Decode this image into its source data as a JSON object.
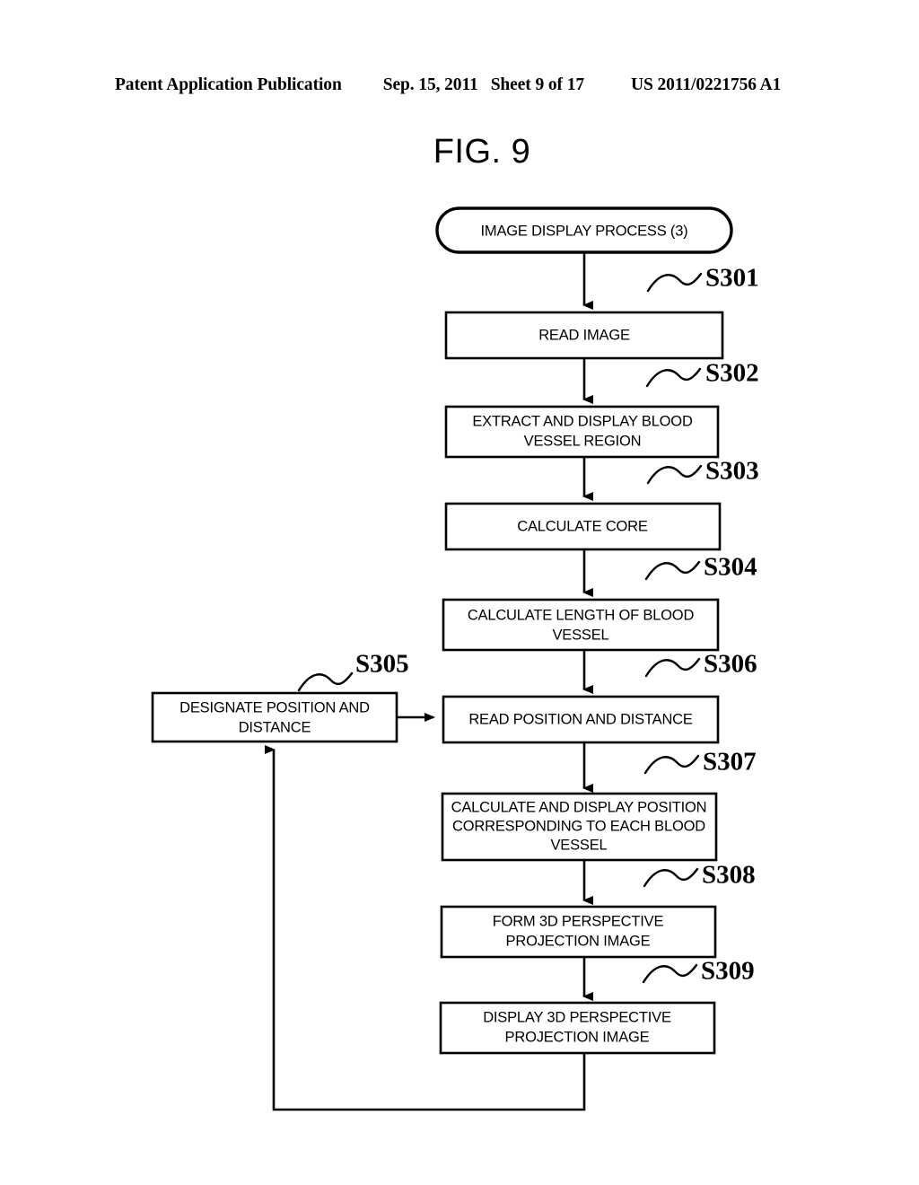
{
  "header": {
    "publication": "Patent Application Publication",
    "date": "Sep. 15, 2011",
    "sheet": "Sheet 9 of 17",
    "number": "US 2011/0221756 A1"
  },
  "figure": {
    "label": "FIG. 9"
  },
  "flowchart": {
    "terminal": {
      "label": "IMAGE DISPLAY PROCESS (3)",
      "lines": [
        "IMAGE DISPLAY PROCESS (3)"
      ]
    },
    "steps": [
      {
        "id": "S301",
        "step_label": "S301",
        "lines": [
          "READ IMAGE"
        ]
      },
      {
        "id": "S302",
        "step_label": "S302",
        "lines": [
          "EXTRACT AND DISPLAY BLOOD",
          "VESSEL REGION"
        ]
      },
      {
        "id": "S303",
        "step_label": "S303",
        "lines": [
          "CALCULATE CORE"
        ]
      },
      {
        "id": "S304",
        "step_label": "S304",
        "lines": [
          "CALCULATE LENGTH OF BLOOD",
          "VESSEL"
        ]
      },
      {
        "id": "S305",
        "step_label": "S305",
        "lines": [
          "DESIGNATE POSITION AND",
          "DISTANCE"
        ]
      },
      {
        "id": "S306",
        "step_label": "S306",
        "lines": [
          "READ POSITION AND DISTANCE"
        ]
      },
      {
        "id": "S307",
        "step_label": "S307",
        "lines": [
          "CALCULATE AND DISPLAY POSITION",
          "CORRESPONDING TO EACH BLOOD",
          "VESSEL"
        ]
      },
      {
        "id": "S308",
        "step_label": "S308",
        "lines": [
          "FORM 3D PERSPECTIVE",
          "PROJECTION IMAGE"
        ]
      },
      {
        "id": "S309",
        "step_label": "S309",
        "lines": [
          "DISPLAY 3D PERSPECTIVE",
          "PROJECTION IMAGE"
        ]
      }
    ],
    "colors": {
      "ink": "#000000",
      "paper": "#ffffff"
    }
  }
}
